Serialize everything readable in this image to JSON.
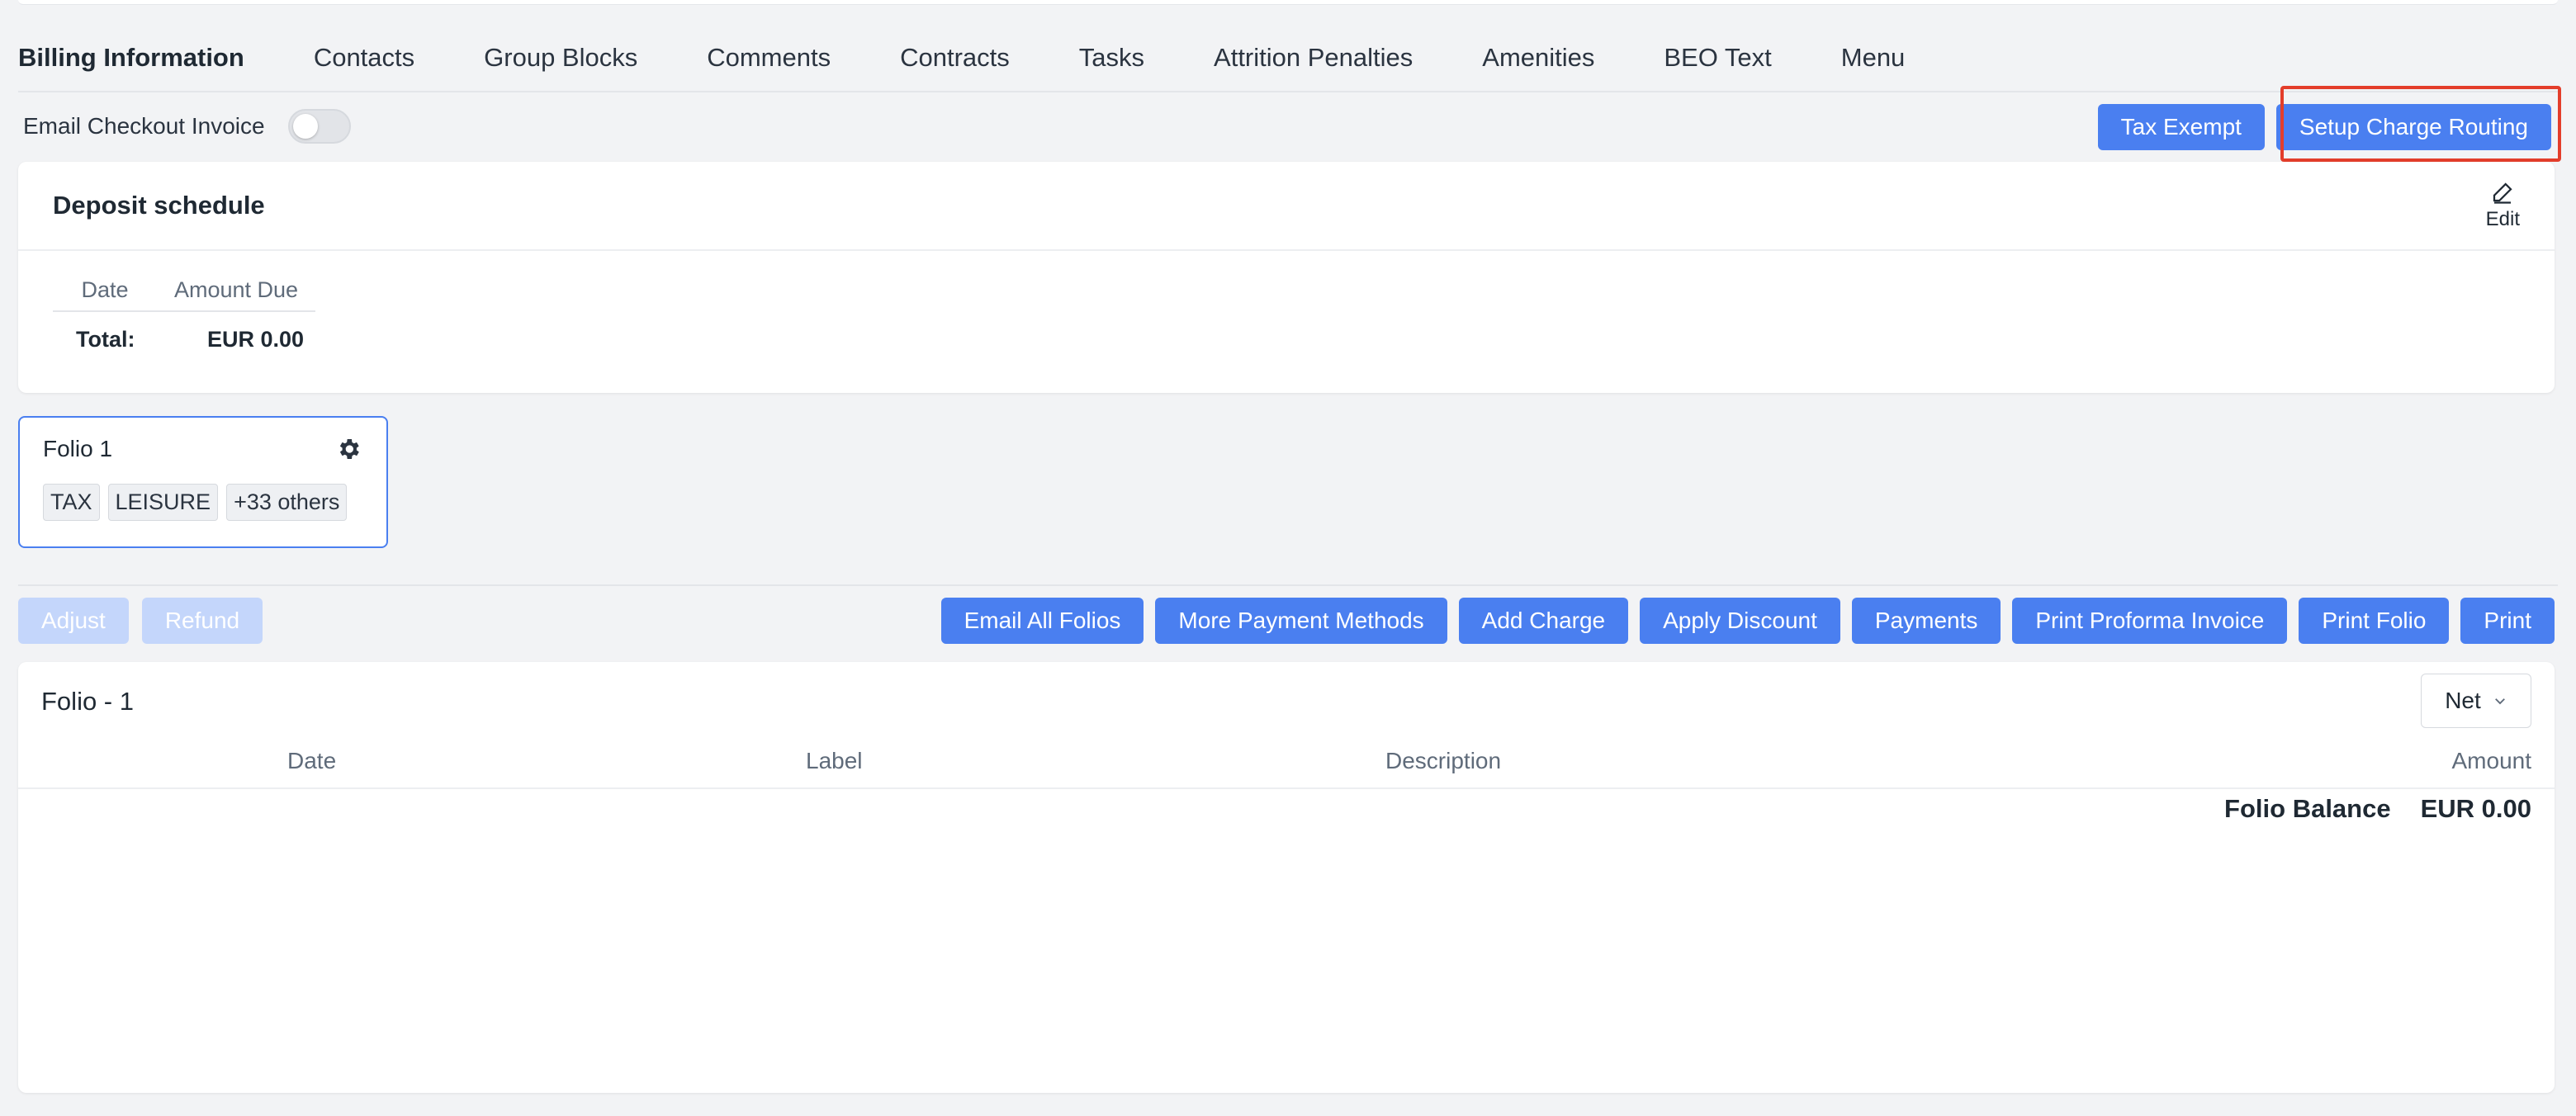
{
  "tabs": [
    {
      "label": "Billing Information",
      "active": true
    },
    {
      "label": "Contacts"
    },
    {
      "label": "Group Blocks"
    },
    {
      "label": "Comments"
    },
    {
      "label": "Contracts"
    },
    {
      "label": "Tasks"
    },
    {
      "label": "Attrition Penalties"
    },
    {
      "label": "Amenities"
    },
    {
      "label": "BEO Text"
    },
    {
      "label": "Menu"
    }
  ],
  "email_checkout": {
    "label": "Email Checkout Invoice",
    "enabled": false
  },
  "top_actions": {
    "tax_exempt": "Tax Exempt",
    "setup_charge_routing": "Setup Charge Routing"
  },
  "deposit": {
    "title": "Deposit schedule",
    "edit_label": "Edit",
    "columns": [
      "Date",
      "Amount Due"
    ],
    "total_label": "Total:",
    "total_value": "EUR 0.00"
  },
  "folio_card": {
    "name": "Folio 1",
    "tags": [
      "TAX",
      "LEISURE",
      "+33 others"
    ]
  },
  "left_actions": {
    "adjust": "Adjust",
    "refund": "Refund"
  },
  "right_actions": [
    "Email All Folios",
    "More Payment Methods",
    "Add Charge",
    "Apply Discount",
    "Payments",
    "Print Proforma Invoice",
    "Print Folio",
    "Print"
  ],
  "folio_detail": {
    "title": "Folio - 1",
    "view_select": "Net",
    "columns": {
      "date": "Date",
      "label": "Label",
      "description": "Description",
      "amount": "Amount"
    },
    "balance_label": "Folio Balance",
    "balance_value": "EUR 0.00"
  },
  "colors": {
    "primary": "#4a7ff0",
    "highlight": "#e33d2a"
  }
}
